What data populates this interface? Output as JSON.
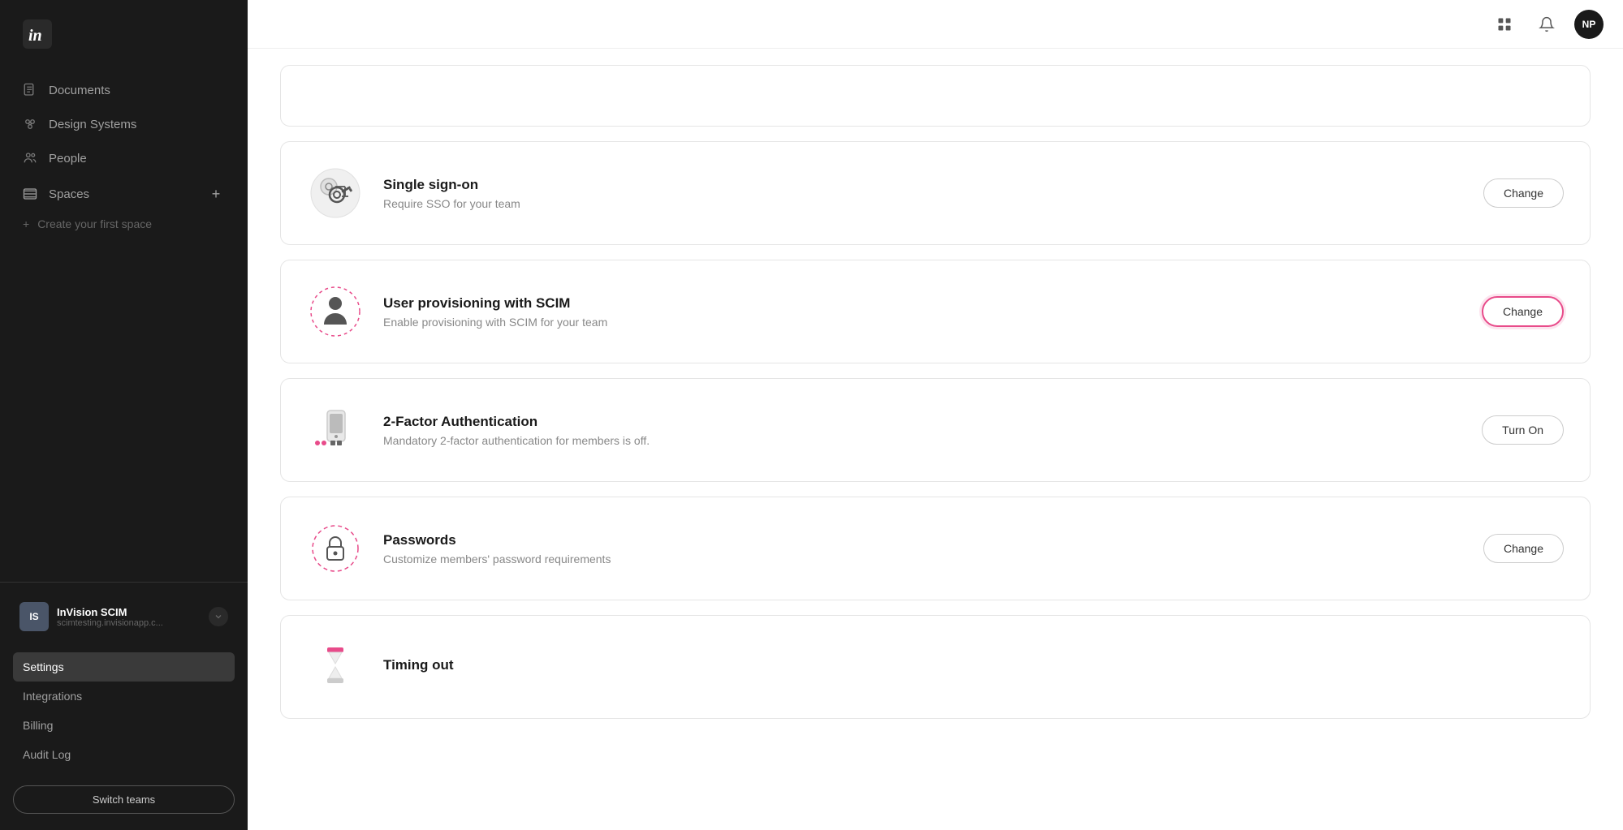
{
  "sidebar": {
    "logo_text": "in",
    "nav_items": [
      {
        "id": "documents",
        "label": "Documents",
        "icon": "document"
      },
      {
        "id": "design-systems",
        "label": "Design Systems",
        "icon": "design-systems"
      },
      {
        "id": "people",
        "label": "People",
        "icon": "people"
      }
    ],
    "spaces_label": "Spaces",
    "create_space_label": "Create your first space",
    "team": {
      "initials": "IS",
      "name": "InVision SCIM",
      "url": "scimtesting.invisionapp.c..."
    },
    "menu_items": [
      {
        "id": "settings",
        "label": "Settings",
        "active": true
      },
      {
        "id": "integrations",
        "label": "Integrations",
        "active": false
      },
      {
        "id": "billing",
        "label": "Billing",
        "active": false
      },
      {
        "id": "audit-log",
        "label": "Audit Log",
        "active": false
      }
    ],
    "switch_teams_label": "Switch teams"
  },
  "header": {
    "grid_icon": "⊞",
    "user_initials": "NP"
  },
  "settings": {
    "cards": [
      {
        "id": "single-sign-on",
        "title": "Single sign-on",
        "description": "Require SSO for your team",
        "action_label": "Change",
        "action_type": "normal",
        "highlighted": false
      },
      {
        "id": "user-provisioning-scim",
        "title": "User provisioning with SCIM",
        "description": "Enable provisioning with SCIM for your team",
        "action_label": "Change",
        "action_type": "normal",
        "highlighted": true
      },
      {
        "id": "two-factor-auth",
        "title": "2-Factor Authentication",
        "description": "Mandatory 2-factor authentication for members is off.",
        "action_label": "Turn On",
        "action_type": "normal",
        "highlighted": false
      },
      {
        "id": "passwords",
        "title": "Passwords",
        "description": "Customize members' password requirements",
        "action_label": "Change",
        "action_type": "normal",
        "highlighted": false
      },
      {
        "id": "timing-out",
        "title": "Timing out",
        "description": "",
        "action_label": "",
        "action_type": "partial",
        "highlighted": false
      }
    ]
  },
  "icons": {
    "document": "📄",
    "design_systems": "⚙",
    "people": "👥",
    "spaces": "📁"
  }
}
